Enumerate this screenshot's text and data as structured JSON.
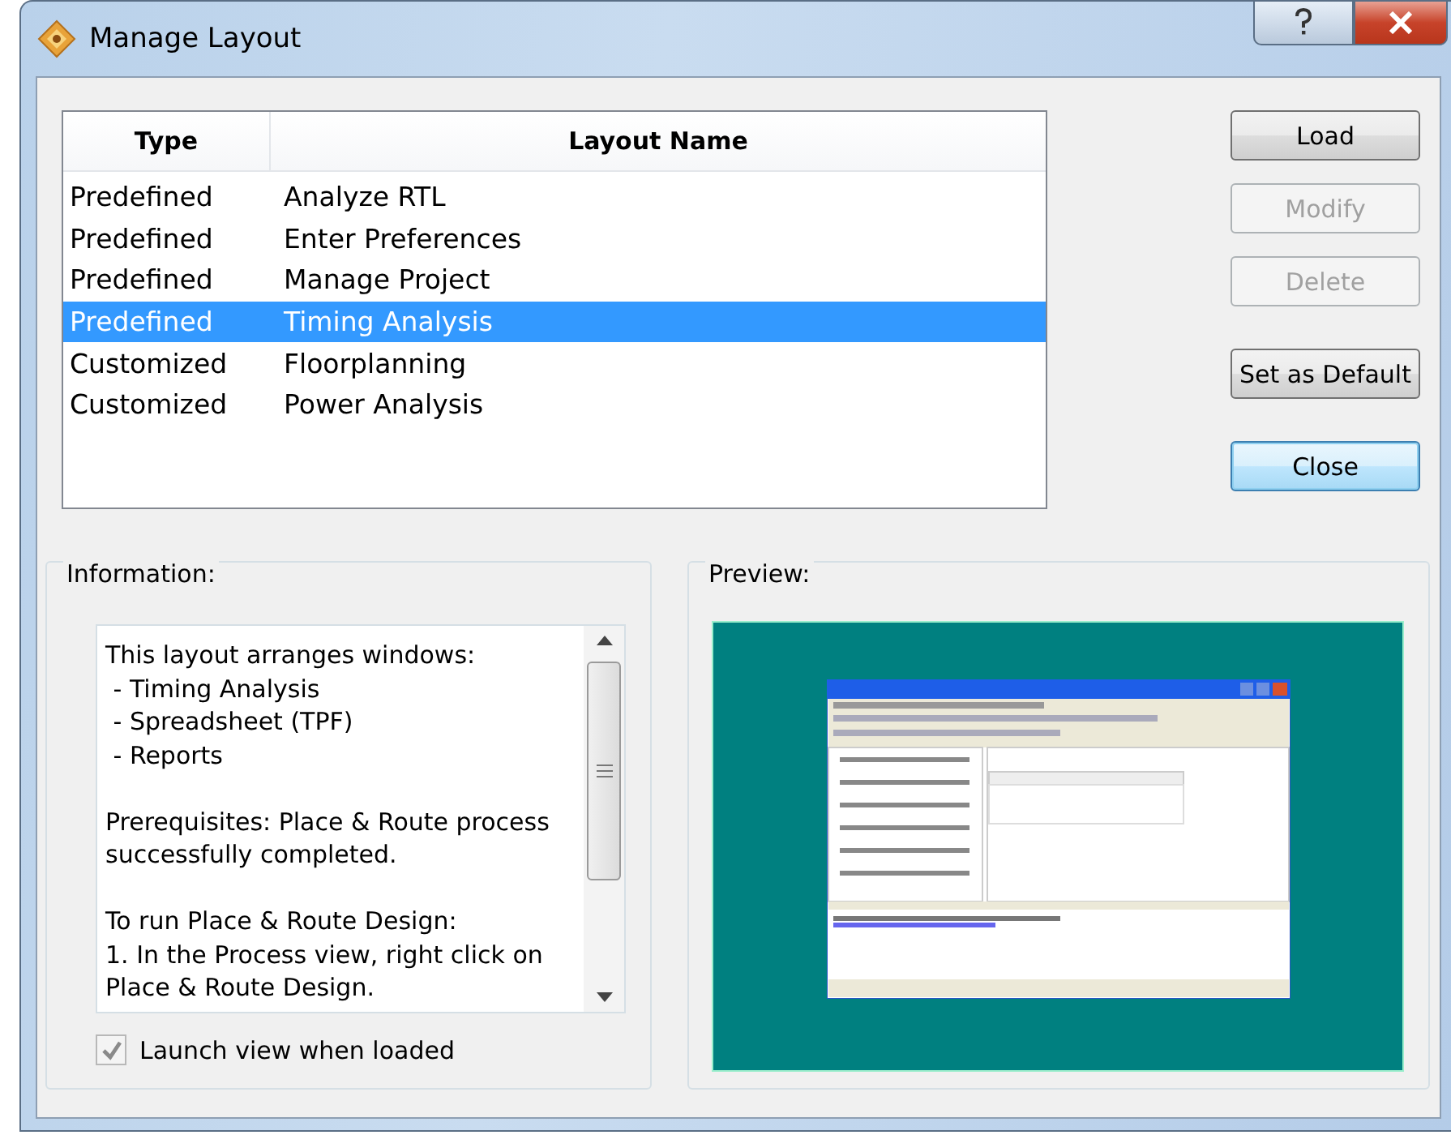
{
  "window": {
    "title": "Manage Layout"
  },
  "table": {
    "columns": [
      "Type",
      "Layout Name"
    ],
    "rows": [
      {
        "type": "Predefined",
        "name": "Analyze RTL",
        "selected": false
      },
      {
        "type": "Predefined",
        "name": "Enter Preferences",
        "selected": false
      },
      {
        "type": "Predefined",
        "name": "Manage Project",
        "selected": false
      },
      {
        "type": "Predefined",
        "name": "Timing Analysis",
        "selected": true
      },
      {
        "type": "Customized",
        "name": "Floorplanning",
        "selected": false
      },
      {
        "type": "Customized",
        "name": "Power Analysis",
        "selected": false
      }
    ]
  },
  "buttons": [
    {
      "label": "Load",
      "disabled": false,
      "default": false
    },
    {
      "label": "Modify",
      "disabled": true,
      "default": false
    },
    {
      "label": "Delete",
      "disabled": true,
      "default": false
    },
    {
      "label": "Set as Default",
      "disabled": false,
      "default": false
    },
    {
      "label": "Close",
      "disabled": false,
      "default": true
    }
  ],
  "information": {
    "title": "Information:",
    "paragraphs": [
      [
        "This layout arranges windows:",
        " - Timing Analysis",
        " - Spreadsheet (TPF)",
        " - Reports"
      ],
      [
        "Prerequisites: Place & Route process",
        "successfully completed."
      ],
      [
        "To run Place & Route Design:",
        "1. In the Process view, right click on",
        "Place & Route Design."
      ]
    ],
    "checkbox": {
      "label": "Launch view when loaded",
      "checked": true,
      "disabled": true
    }
  },
  "preview": {
    "title": "Preview:"
  }
}
